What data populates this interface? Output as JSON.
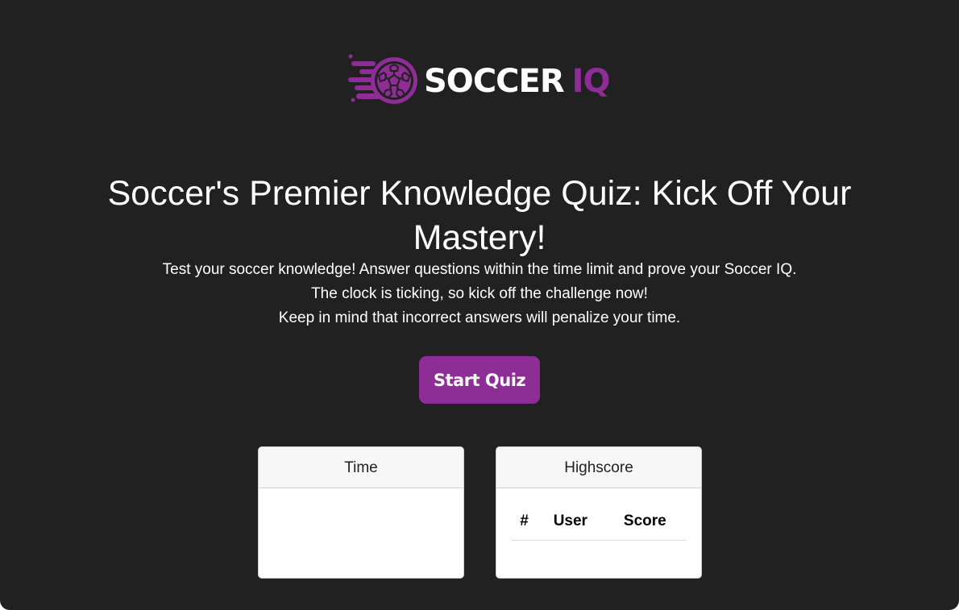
{
  "brand": {
    "logo_icon": "soccer-ball-icon",
    "logo_word1": "SOCCER",
    "logo_word2": "IQ",
    "accent_color": "#8e2d96",
    "background_color": "#212121"
  },
  "hero": {
    "title": "Soccer's Premier Knowledge Quiz: Kick Off Your Mastery!",
    "intro_lines": [
      "Test your soccer knowledge! Answer questions within the time limit and prove your Soccer IQ.",
      "The clock is ticking, so kick off the challenge now!",
      "Keep in mind that incorrect answers will penalize your time."
    ],
    "start_label": "Start Quiz"
  },
  "time_card": {
    "header": "Time",
    "value": ""
  },
  "highscore_card": {
    "header": "Highscore",
    "columns": [
      "#",
      "User",
      "Score"
    ],
    "rows": []
  }
}
